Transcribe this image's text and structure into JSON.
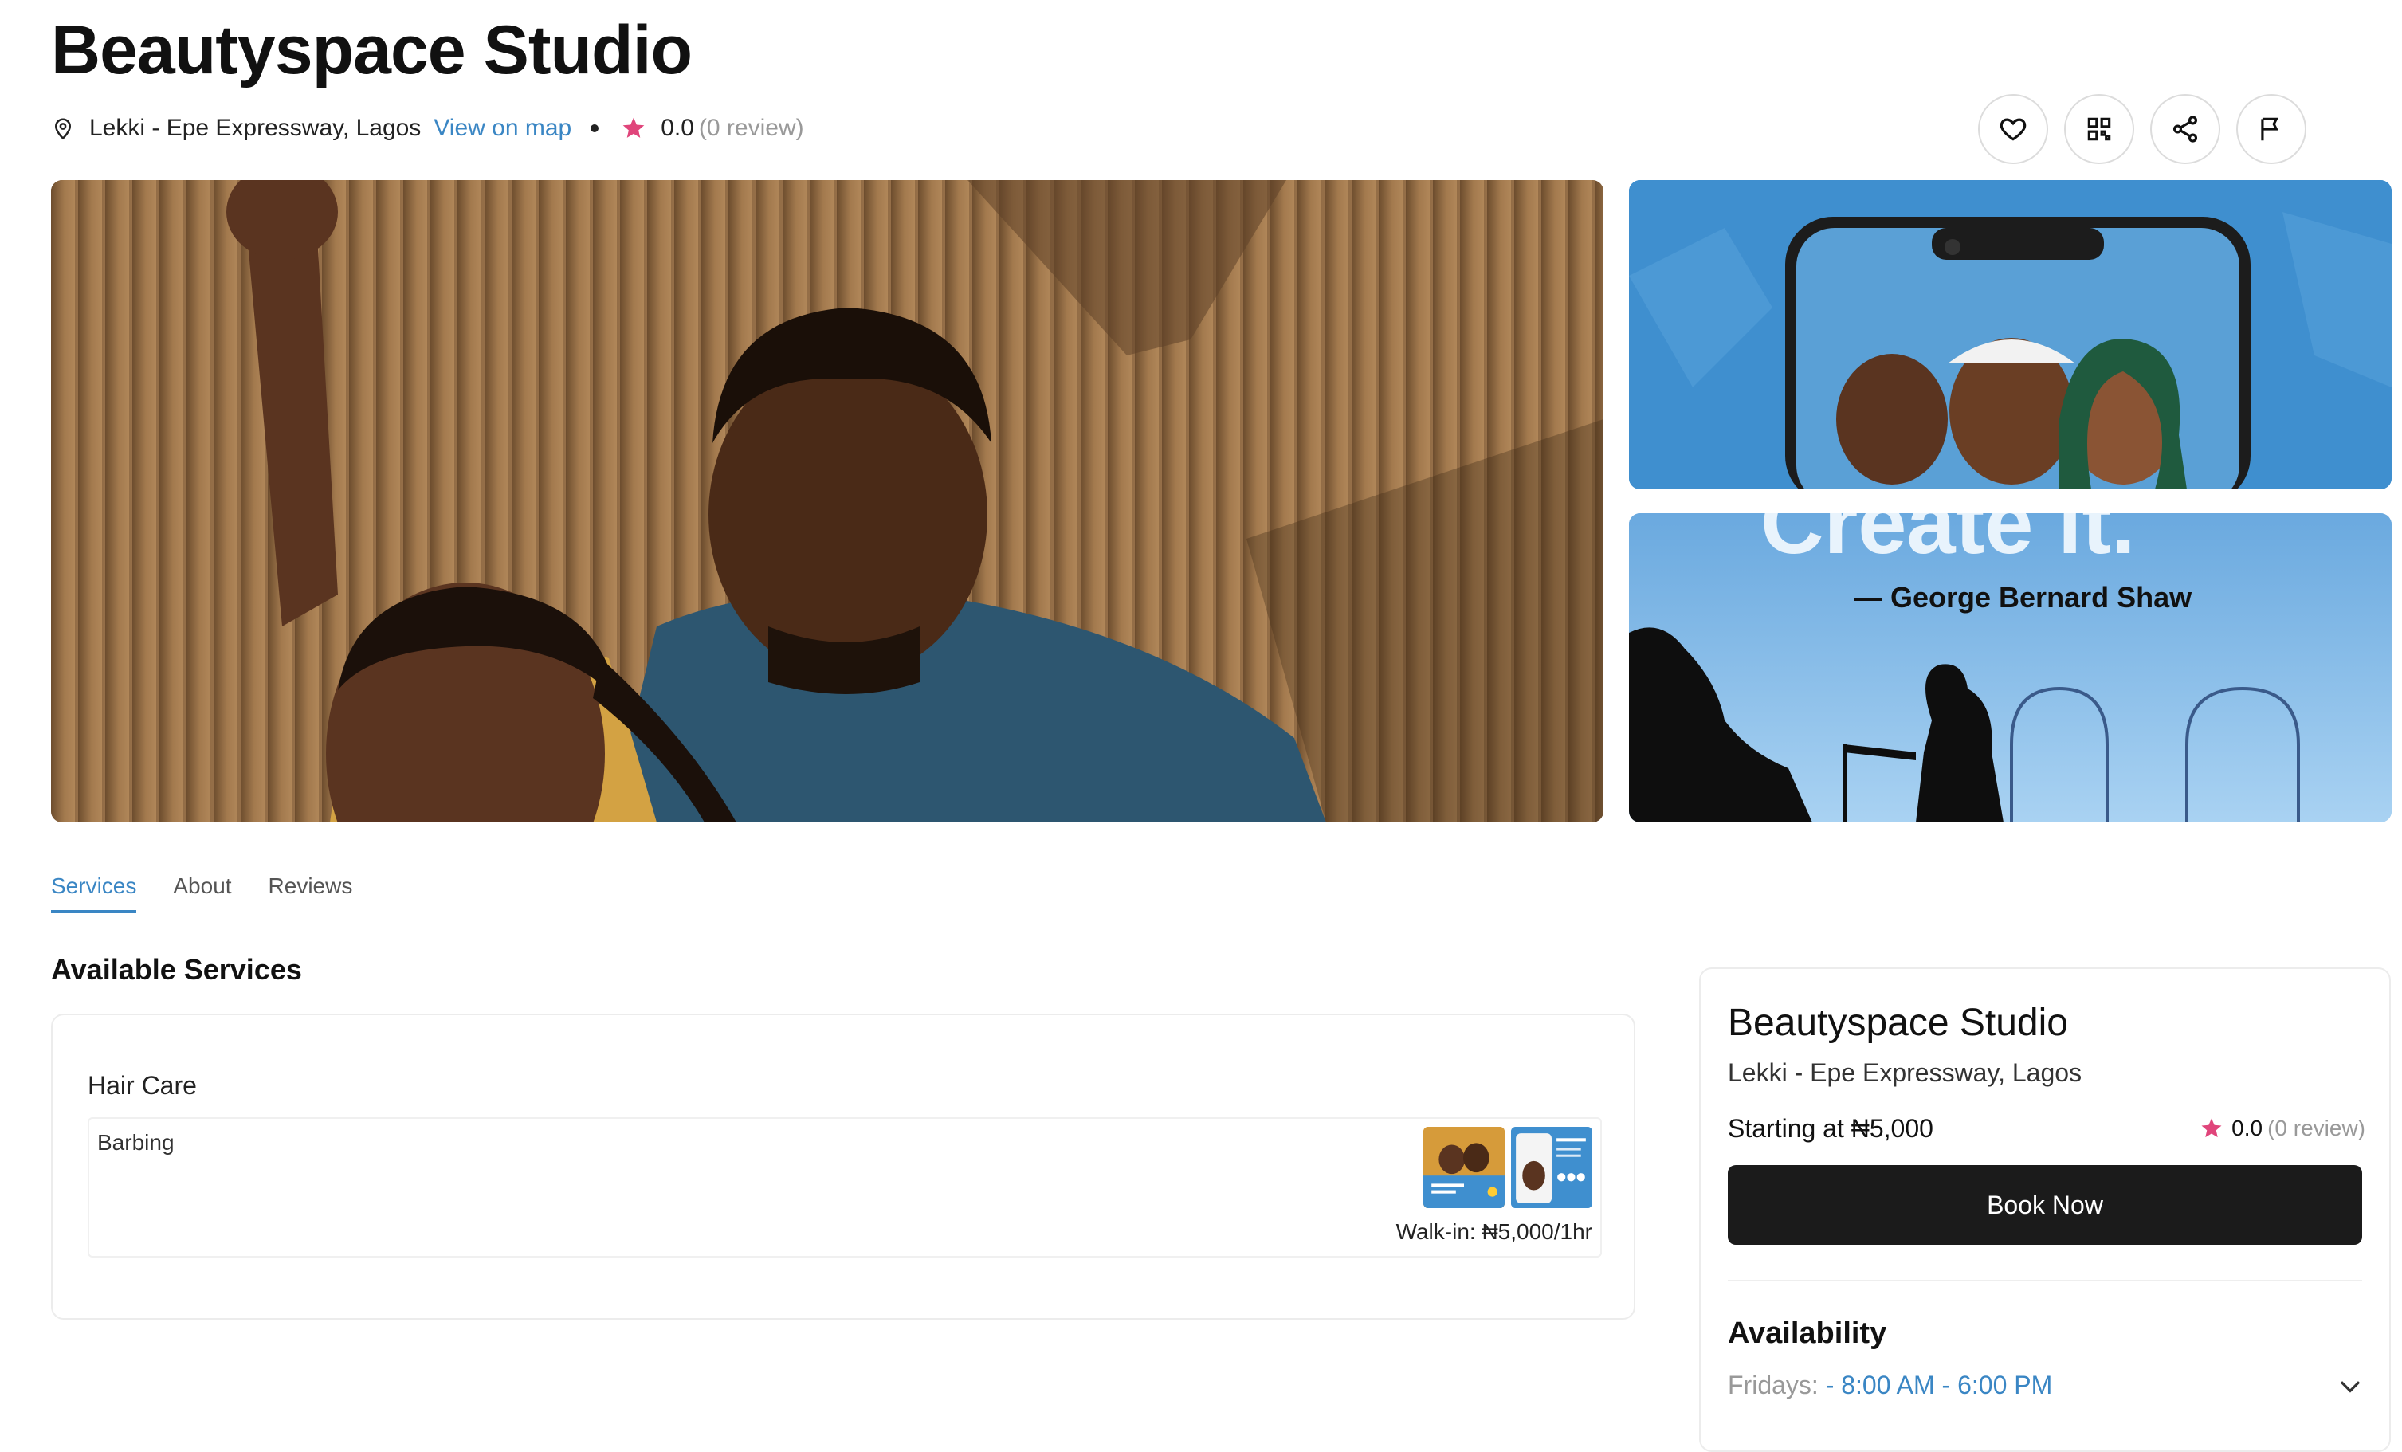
{
  "business": {
    "name": "Beautyspace Studio",
    "location": "Lekki - Epe Expressway, Lagos",
    "view_on_map": "View on map",
    "rating": "0.0",
    "reviews": "(0 review)"
  },
  "actions": [
    "favorite",
    "qr-code",
    "share",
    "report"
  ],
  "gallery": {
    "quote_author": "— George Bernard Shaw",
    "quote_fragment": "Create it."
  },
  "tabs": [
    {
      "label": "Services",
      "active": true
    },
    {
      "label": "About",
      "active": false
    },
    {
      "label": "Reviews",
      "active": false
    }
  ],
  "services": {
    "heading": "Available Services",
    "category": "Hair Care",
    "items": [
      {
        "name": "Barbing",
        "price": "Walk-in: ₦5,000/1hr"
      }
    ]
  },
  "booking": {
    "name": "Beautyspace Studio",
    "location": "Lekki - Epe Expressway, Lagos",
    "starting": "Starting at ₦5,000",
    "rating": "0.0",
    "reviews": "(0 review)",
    "button": "Book Now",
    "availability_title": "Availability",
    "availability_day": "Fridays: ",
    "availability_hours": "- 8:00 AM - 6:00 PM"
  },
  "colors": {
    "accent": "#3a86c4",
    "star": "#e0457b",
    "button": "#1b1b1b"
  }
}
